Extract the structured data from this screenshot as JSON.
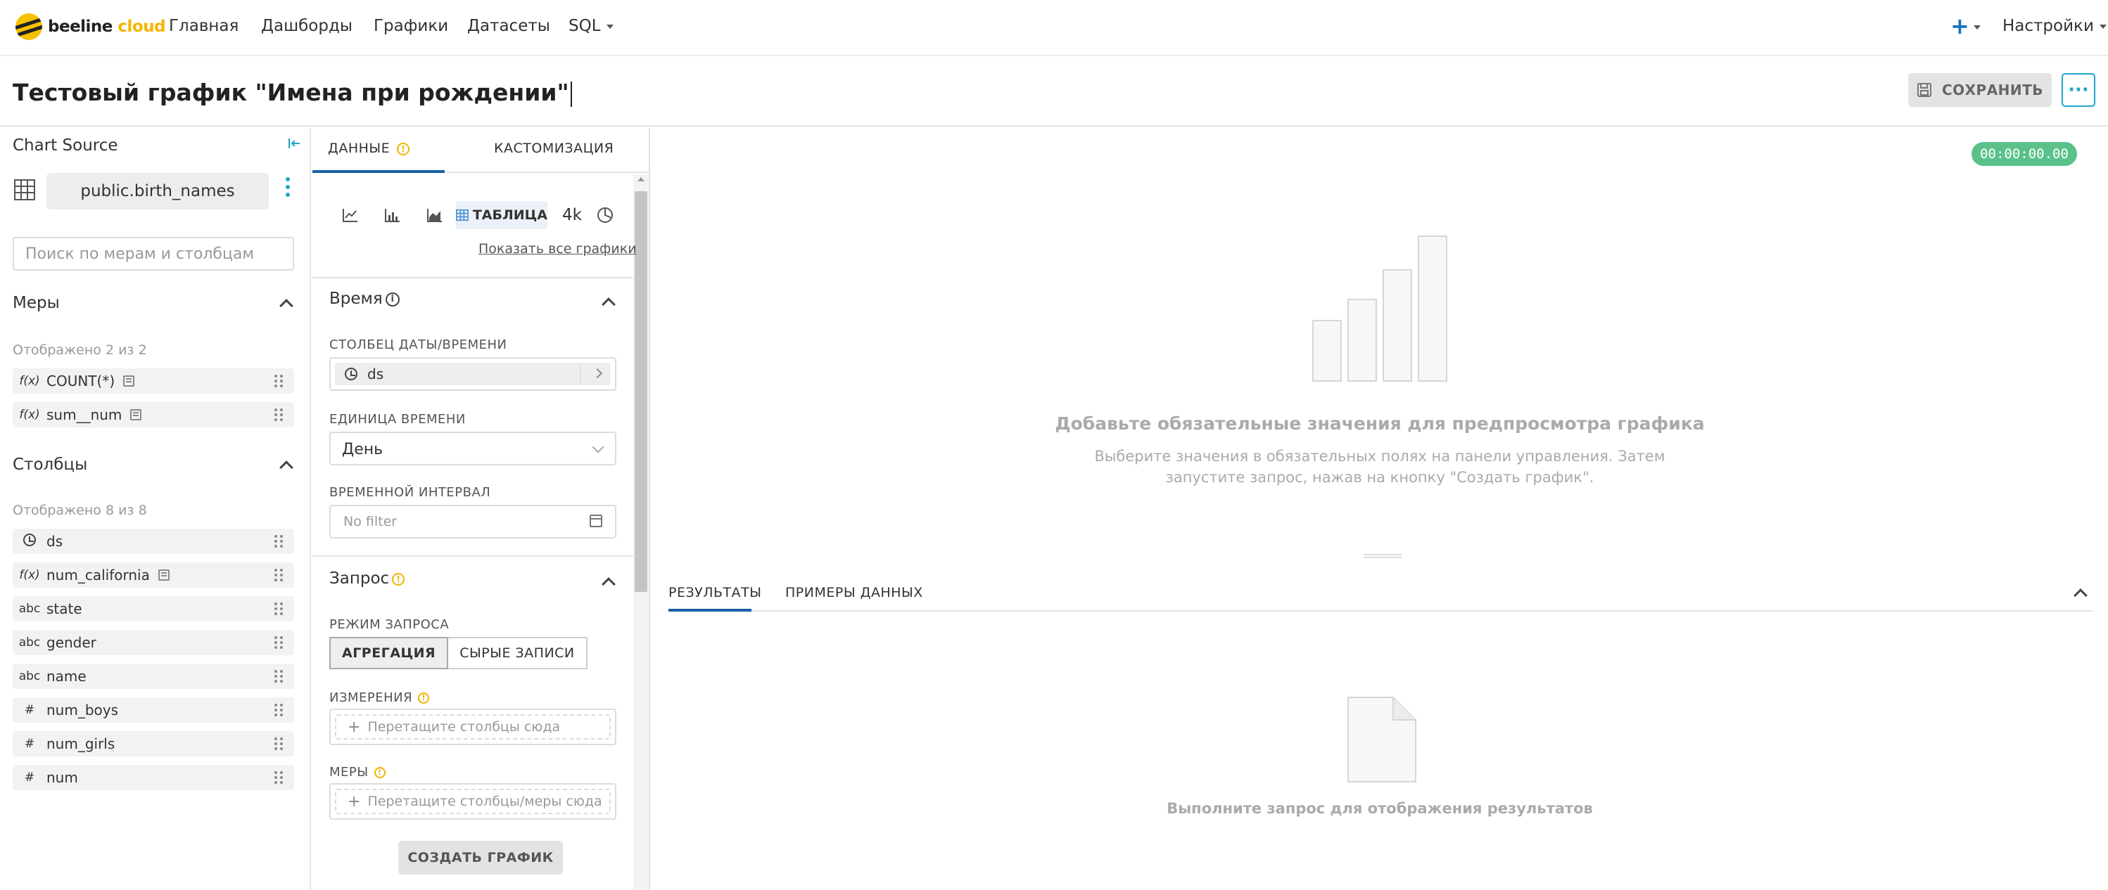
{
  "nav": {
    "brand_main": "beeline",
    "brand_accent": "cloud",
    "items": [
      "Главная",
      "Дашборды",
      "Графики",
      "Датасеты",
      "SQL"
    ],
    "plus": "+",
    "settings": "Настройки"
  },
  "header": {
    "title": "Тестовый график \"Имена при рождении\"",
    "save_label": "СОХРАНИТЬ",
    "more_label": "···"
  },
  "datasource": {
    "title": "Chart Source",
    "name": "public.birth_names",
    "search_placeholder": "Поиск по мерам и столбцам",
    "metrics_title": "Меры",
    "metrics_shown": "Отображено 2 из 2",
    "metrics": [
      {
        "type": "f(x)",
        "name": "COUNT(*)"
      },
      {
        "type": "f(x)",
        "name": "sum__num"
      }
    ],
    "columns_title": "Столбцы",
    "columns_shown": "Отображено 8 из 8",
    "columns": [
      {
        "type": "clock",
        "name": "ds"
      },
      {
        "type": "f(x)",
        "name": "num_california"
      },
      {
        "type": "abc",
        "name": "state"
      },
      {
        "type": "abc",
        "name": "gender"
      },
      {
        "type": "abc",
        "name": "name"
      },
      {
        "type": "#",
        "name": "num_boys"
      },
      {
        "type": "#",
        "name": "num_girls"
      },
      {
        "type": "#",
        "name": "num"
      }
    ]
  },
  "controls": {
    "tab_data": "ДАННЫЕ",
    "tab_customize": "КАСТОМИЗАЦИЯ",
    "viz_selected": "ТАБЛИЦА",
    "viz_big_number": "4k",
    "show_all_charts": "Показать все графики",
    "time_section": "Время",
    "time_column_label": "СТОЛБЕЦ ДАТЫ/ВРЕМЕНИ",
    "time_column_value": "ds",
    "time_grain_label": "ЕДИНИЦА ВРЕМЕНИ",
    "time_grain_value": "День",
    "time_range_label": "ВРЕМЕННОЙ ИНТЕРВАЛ",
    "time_range_value": "No filter",
    "query_section": "Запрос",
    "query_mode_label": "РЕЖИМ ЗАПРОСА",
    "query_mode_aggregate": "АГРЕГАЦИЯ",
    "query_mode_raw": "СЫРЫЕ ЗАПИСИ",
    "dimensions_label": "ИЗМЕРЕНИЯ",
    "dimensions_placeholder": "Перетащите столбцы сюда",
    "metrics_label": "МЕРЫ",
    "metrics_placeholder": "Перетащите столбцы/меры сюда",
    "create_chart": "СОЗДАТЬ ГРАФИК"
  },
  "chart_area": {
    "timer": "00:00:00.00",
    "empty_title": "Добавьте обязательные значения для предпросмотра графика",
    "empty_desc": "Выберите значения в обязательных полях на панели управления. Затем запустите запрос, нажав на кнопку \"Создать график\".",
    "tab_results": "РЕЗУЛЬТАТЫ",
    "tab_samples": "ПРИМЕРЫ ДАННЫХ",
    "results_empty": "Выполните запрос для отображения результатов"
  },
  "colors": {
    "accent": "#20a7c9",
    "tab_active": "#1a5fa8",
    "timer": "#5ac189",
    "warning": "#f0b400",
    "brand_yellow": "#f5c100"
  }
}
